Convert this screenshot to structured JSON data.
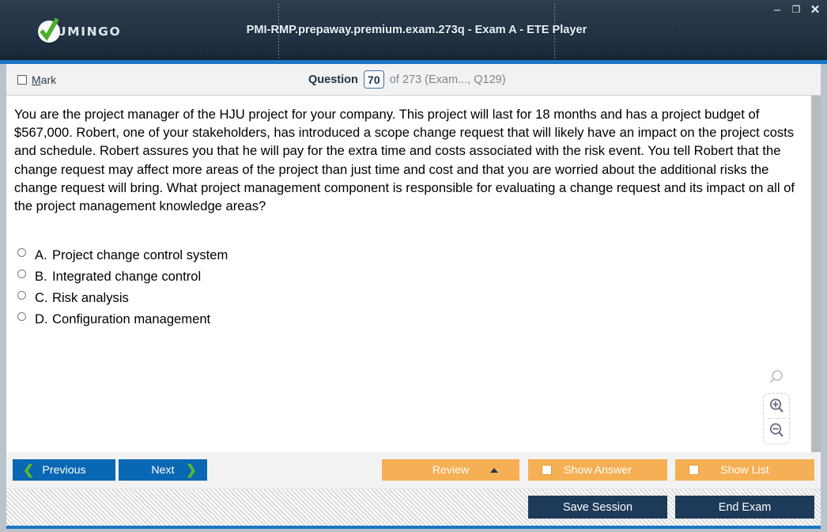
{
  "window": {
    "title": "PMI-RMP.prepaway.premium.exam.273q - Exam A - ETE Player",
    "brand_name": "UMINGO",
    "brand_icon": "green-check-circle-icon",
    "controls": {
      "minimize": "–",
      "maximize": "❐",
      "close": "✕"
    },
    "accent_color": "#1976c4",
    "titlebar_color": "#233345"
  },
  "question_bar": {
    "mark_label_prefix": "M",
    "mark_label_rest": "ark",
    "mark_checked": false,
    "question_word": "Question",
    "question_number": "70",
    "of_text": "of 273 (Exam..., Q129)"
  },
  "question": {
    "text": "You are the project manager of the HJU project for your company. This project will last for 18 months and has a project budget of $567,000. Robert, one of your stakeholders, has introduced a scope change request that will likely have an impact on the project costs and schedule. Robert assures you that he will pay for the extra time and costs associated with the risk event. You tell Robert that the change request may affect more areas of the project than just time and cost and that you are worried about the additional risks the change request will bring. What project management component is responsible for evaluating a change request and its impact on all of the project management knowledge areas?",
    "options": [
      {
        "letter": "A.",
        "text": "Project change control system",
        "selected": false
      },
      {
        "letter": "B.",
        "text": "Integrated change control",
        "selected": false
      },
      {
        "letter": "C.",
        "text": "Risk analysis",
        "selected": false
      },
      {
        "letter": "D.",
        "text": "Configuration management",
        "selected": false
      }
    ]
  },
  "zoom_tools": {
    "magnifier_icon": "magnifier-icon",
    "zoom_in_icon": "magnifier-plus-icon",
    "zoom_out_icon": "magnifier-minus-icon"
  },
  "actions": {
    "previous_label": "Previous",
    "previous_chevron": "❮",
    "next_label": "Next",
    "next_chevron": "❯",
    "review_label": "Review",
    "show_answer_label": "Show Answer",
    "show_answer_checked": false,
    "show_list_label": "Show List",
    "show_list_checked": false,
    "orange_color": "#f5af54",
    "blue_color": "#0a67b3",
    "chevron_color": "#5cb82c"
  },
  "footer": {
    "save_session_label": "Save Session",
    "end_exam_label": "End Exam",
    "navy_color": "#1d3b59"
  }
}
